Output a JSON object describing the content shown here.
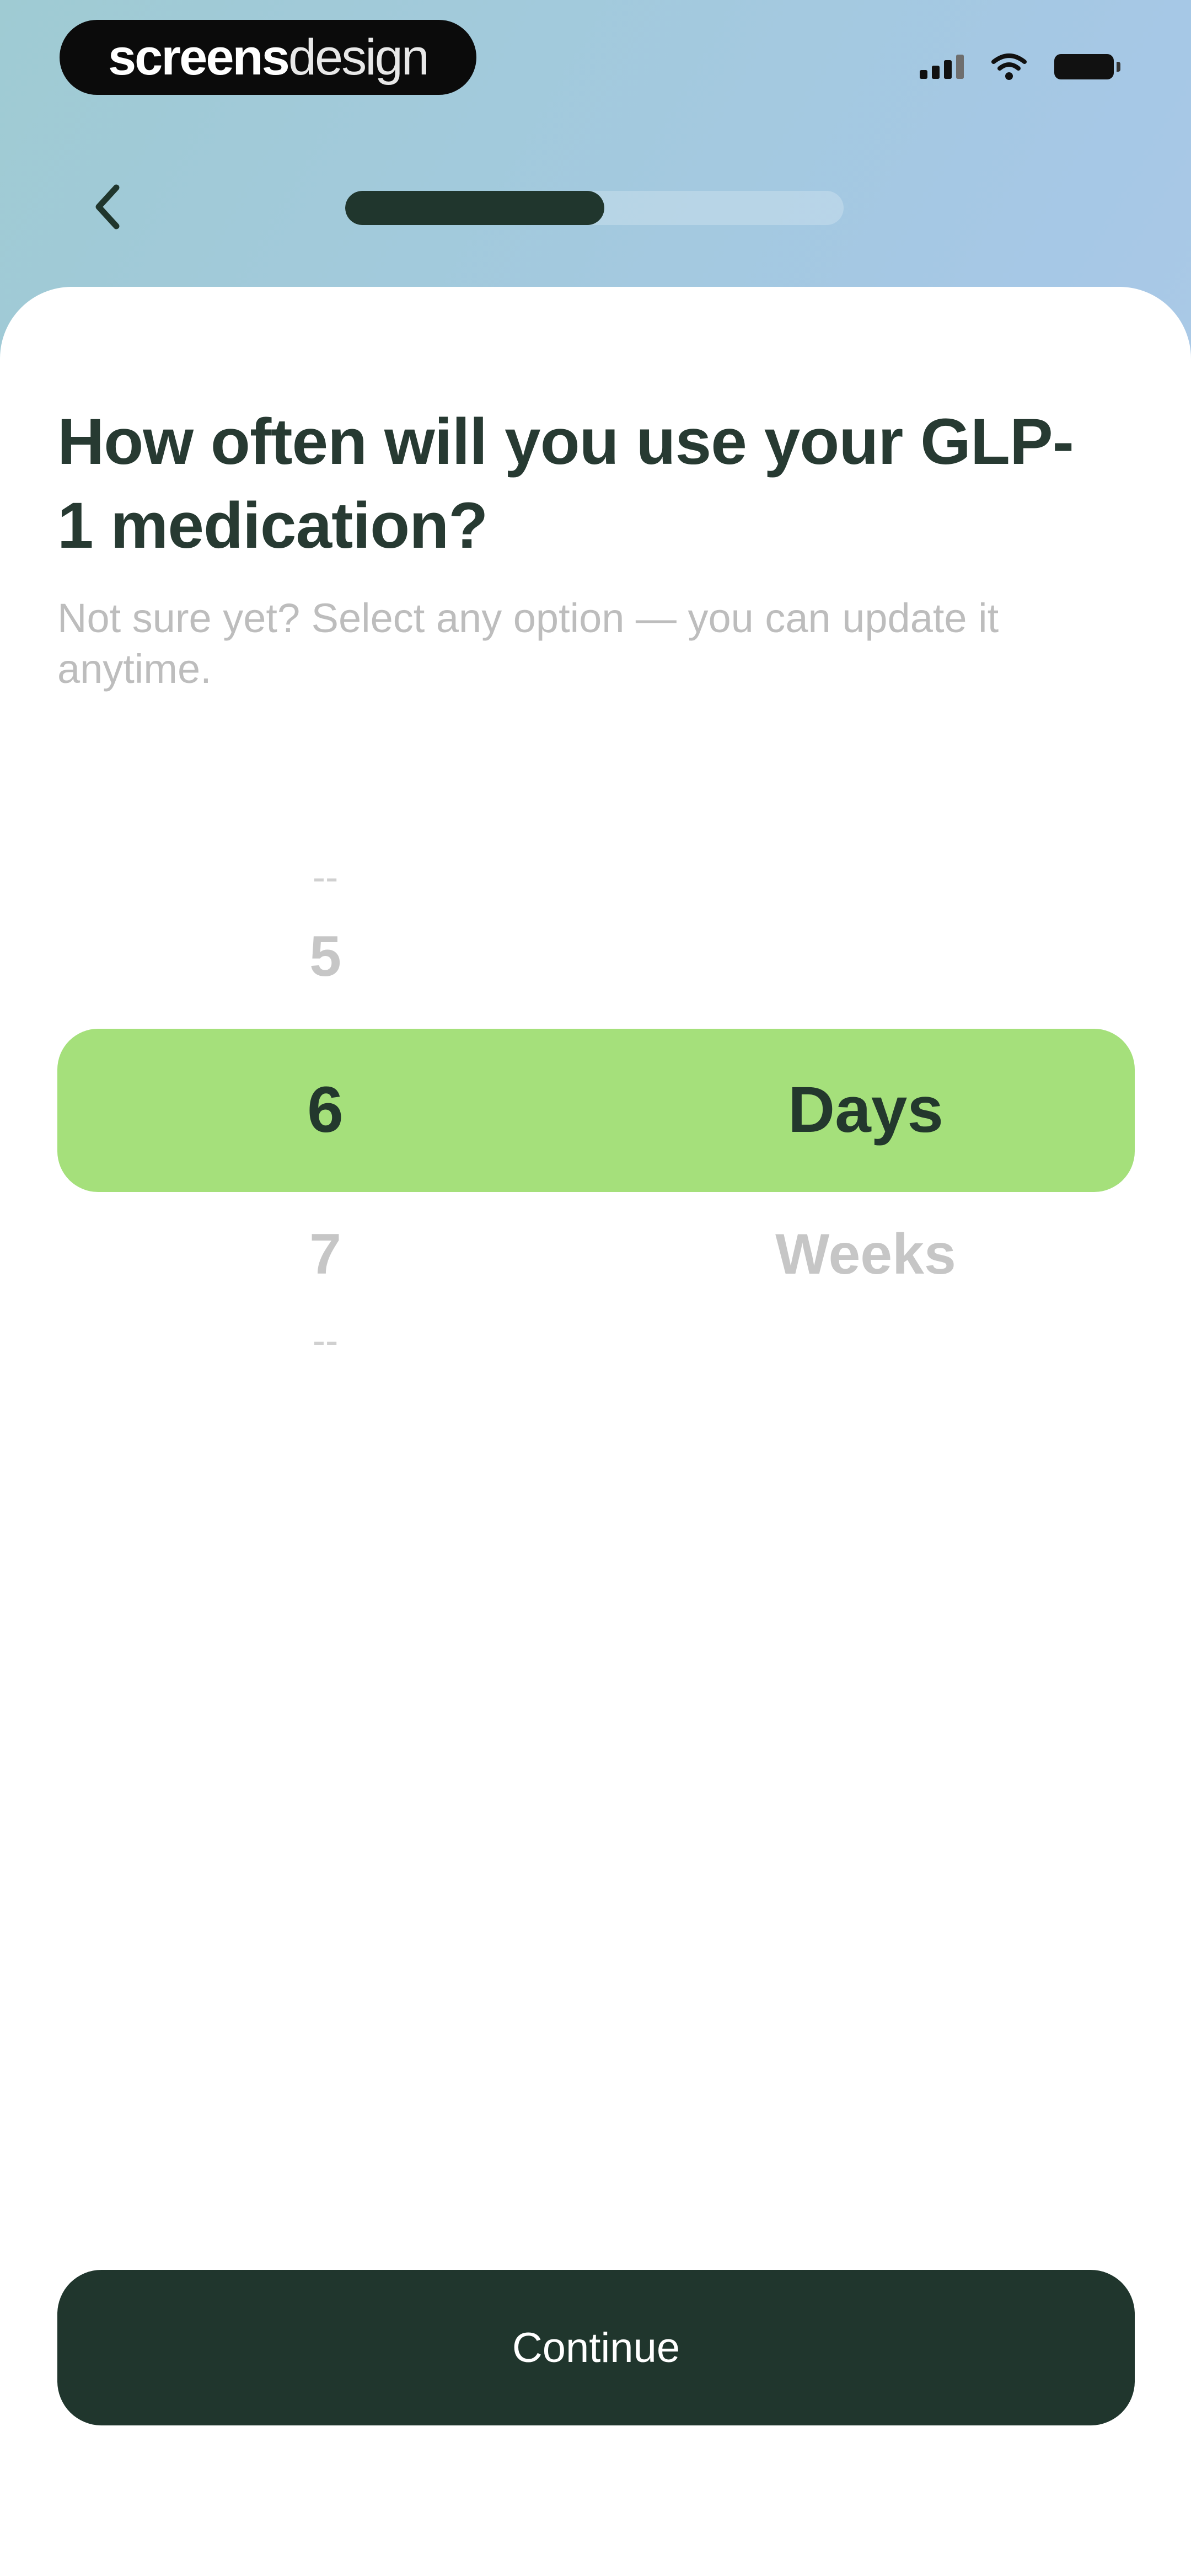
{
  "status_bar": {
    "brand_bold": "screens",
    "brand_light": "design"
  },
  "nav": {
    "back_icon": "chevron-left-icon",
    "progress": 0.52
  },
  "question": {
    "title": "How often will you use your GLP-1 medication?",
    "subtitle": "Not sure yet? Select any option — you can update it anytime."
  },
  "picker": {
    "numbers": [
      "--",
      "5",
      "6",
      "7",
      "--"
    ],
    "selected_number": "6",
    "units": [
      "Days",
      "Weeks"
    ],
    "selected_unit": "Days"
  },
  "footer": {
    "continue_label": "Continue"
  },
  "colors": {
    "accent_green": "#a5e07b",
    "dark_green": "#20362d"
  }
}
